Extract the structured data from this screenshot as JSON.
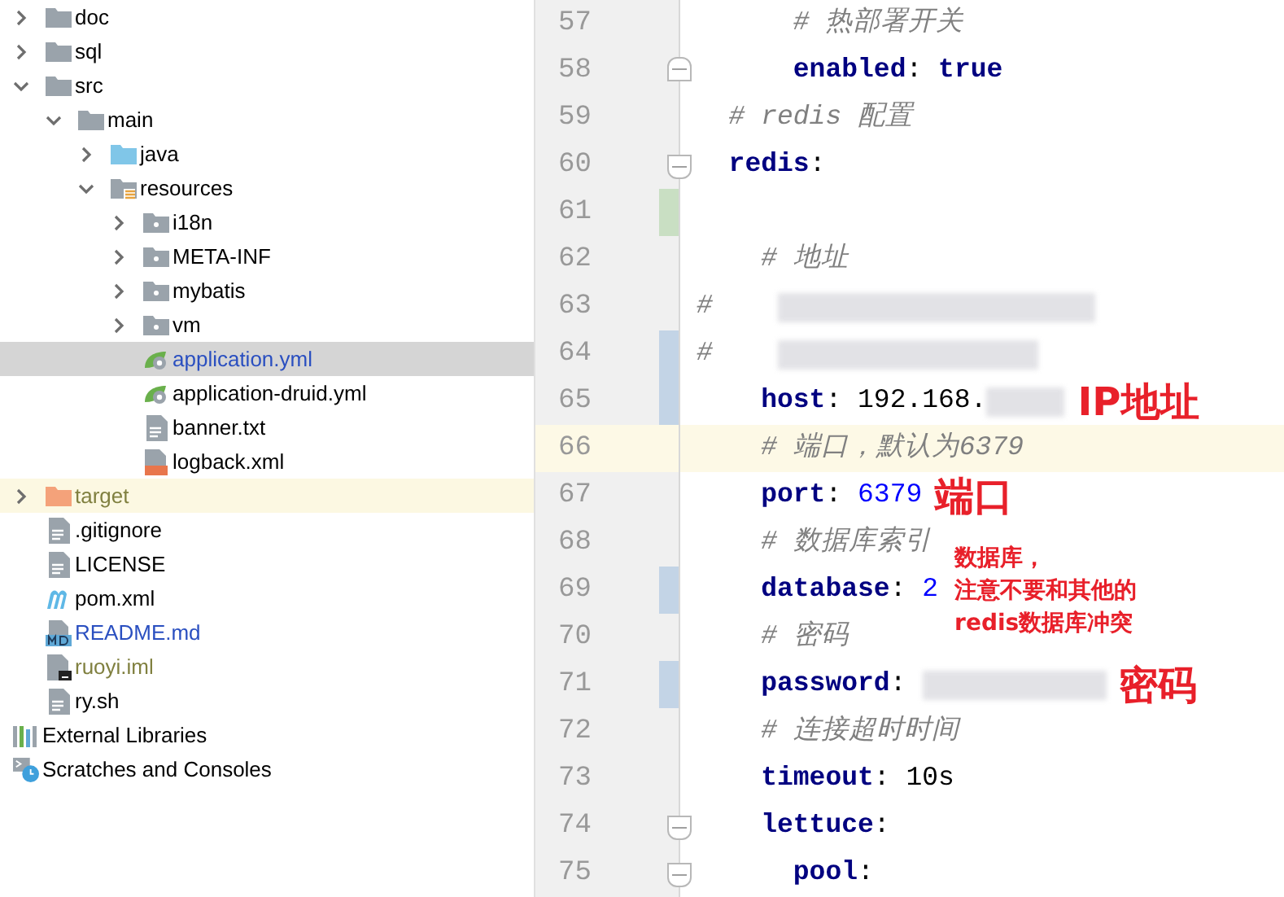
{
  "project_tree": [
    {
      "label": "doc",
      "kind": "folder",
      "expanded": false,
      "selected": false,
      "modified": false,
      "ignored": false
    },
    {
      "label": "sql",
      "kind": "folder",
      "expanded": false,
      "selected": false,
      "modified": false,
      "ignored": false
    },
    {
      "label": "src",
      "kind": "folder",
      "expanded": true,
      "selected": false,
      "modified": false,
      "ignored": false,
      "children": [
        {
          "label": "main",
          "kind": "folder",
          "expanded": true,
          "selected": false,
          "modified": false,
          "ignored": false,
          "children": [
            {
              "label": "java",
              "kind": "source_folder",
              "expanded": false,
              "selected": false,
              "modified": false,
              "ignored": false
            },
            {
              "label": "resources",
              "kind": "resources_folder",
              "expanded": true,
              "selected": false,
              "modified": false,
              "ignored": false,
              "children": [
                {
                  "label": "i18n",
                  "kind": "package_folder",
                  "expanded": false,
                  "selected": false,
                  "modified": false,
                  "ignored": false
                },
                {
                  "label": "META-INF",
                  "kind": "package_folder",
                  "expanded": false,
                  "selected": false,
                  "modified": false,
                  "ignored": false
                },
                {
                  "label": "mybatis",
                  "kind": "package_folder",
                  "expanded": false,
                  "selected": false,
                  "modified": false,
                  "ignored": false
                },
                {
                  "label": "vm",
                  "kind": "package_folder",
                  "expanded": false,
                  "selected": false,
                  "modified": false,
                  "ignored": false
                },
                {
                  "label": "application.yml",
                  "kind": "spring_yml",
                  "selected": true,
                  "modified": true,
                  "ignored": false
                },
                {
                  "label": "application-druid.yml",
                  "kind": "spring_yml",
                  "selected": false,
                  "modified": false,
                  "ignored": false
                },
                {
                  "label": "banner.txt",
                  "kind": "text_file",
                  "selected": false,
                  "modified": false,
                  "ignored": false
                },
                {
                  "label": "logback.xml",
                  "kind": "xml_file",
                  "selected": false,
                  "modified": false,
                  "ignored": false
                }
              ]
            }
          ]
        }
      ]
    },
    {
      "label": "target",
      "kind": "excluded_folder",
      "expanded": false,
      "selected": false,
      "modified": false,
      "ignored": true
    },
    {
      "label": ".gitignore",
      "kind": "text_file",
      "selected": false,
      "modified": false,
      "ignored": false
    },
    {
      "label": "LICENSE",
      "kind": "text_file",
      "selected": false,
      "modified": false,
      "ignored": false
    },
    {
      "label": "pom.xml",
      "kind": "maven_file",
      "selected": false,
      "modified": false,
      "ignored": false
    },
    {
      "label": "README.md",
      "kind": "markdown_file",
      "selected": false,
      "modified": true,
      "ignored": false
    },
    {
      "label": "ruoyi.iml",
      "kind": "module_file",
      "selected": false,
      "modified": false,
      "ignored": true
    },
    {
      "label": "ry.sh",
      "kind": "text_file",
      "selected": false,
      "modified": false,
      "ignored": false
    }
  ],
  "root_items": [
    {
      "label": "External Libraries",
      "kind": "libraries",
      "selected": false
    },
    {
      "label": "Scratches and Consoles",
      "kind": "scratches",
      "selected": false
    }
  ],
  "editor_lines": [
    {
      "number": "57",
      "current": false,
      "added": false,
      "modified": false,
      "fold_start": false,
      "fold_end": false,
      "tokens": [
        {
          "kind": "comment",
          "text": "      # 热部署开关"
        }
      ]
    },
    {
      "number": "58",
      "current": false,
      "added": false,
      "modified": false,
      "fold_start": false,
      "fold_end": true,
      "tokens": [
        {
          "kind": "key",
          "text": "      enabled"
        },
        {
          "kind": "plain",
          "text": ": "
        },
        {
          "kind": "key",
          "text": "true"
        }
      ]
    },
    {
      "number": "59",
      "current": false,
      "added": false,
      "modified": false,
      "fold_start": false,
      "fold_end": false,
      "tokens": [
        {
          "kind": "comment",
          "text": "  # redis 配置"
        }
      ]
    },
    {
      "number": "60",
      "current": false,
      "added": false,
      "modified": false,
      "fold_start": true,
      "fold_end": false,
      "tokens": [
        {
          "kind": "key",
          "text": "  redis"
        },
        {
          "kind": "plain",
          "text": ":"
        }
      ]
    },
    {
      "number": "61",
      "current": false,
      "added": true,
      "modified": false,
      "fold_start": false,
      "fold_end": false
    },
    {
      "number": "62",
      "current": false,
      "added": false,
      "modified": false,
      "fold_start": false,
      "fold_end": false,
      "tokens": [
        {
          "kind": "comment",
          "text": "    # 地址"
        }
      ]
    },
    {
      "number": "63",
      "current": false,
      "added": false,
      "modified": false,
      "fold_start": false,
      "fold_end": false,
      "tokens": [
        {
          "kind": "comment",
          "text": "#    "
        },
        {
          "kind": "redacted_long"
        }
      ]
    },
    {
      "number": "64",
      "current": false,
      "added": false,
      "modified": true,
      "fold_start": false,
      "fold_end": false,
      "tokens": [
        {
          "kind": "comment",
          "text": "#    "
        },
        {
          "kind": "redacted_medium"
        }
      ]
    },
    {
      "number": "65",
      "current": false,
      "added": false,
      "modified": true,
      "fold_start": false,
      "fold_end": false,
      "tokens": [
        {
          "kind": "key",
          "text": "    host"
        },
        {
          "kind": "plain",
          "text": ": 192.168."
        },
        {
          "kind": "redacted_short"
        },
        {
          "kind": "note",
          "text": "IP地址"
        }
      ]
    },
    {
      "number": "66",
      "current": true,
      "added": false,
      "modified": false,
      "fold_start": false,
      "fold_end": false,
      "tokens": [
        {
          "kind": "comment",
          "text": "    # 端口，默认为6379"
        }
      ]
    },
    {
      "number": "67",
      "current": false,
      "added": false,
      "modified": false,
      "fold_start": false,
      "fold_end": false,
      "tokens": [
        {
          "kind": "key",
          "text": "    port"
        },
        {
          "kind": "plain",
          "text": ": "
        },
        {
          "kind": "number",
          "text": "6379"
        },
        {
          "kind": "note",
          "text": "端口"
        }
      ]
    },
    {
      "number": "68",
      "current": false,
      "added": false,
      "modified": false,
      "fold_start": false,
      "fold_end": false,
      "tokens": [
        {
          "kind": "comment",
          "text": "    # 数据库索引"
        }
      ]
    },
    {
      "number": "69",
      "current": false,
      "added": false,
      "modified": true,
      "fold_start": false,
      "fold_end": false,
      "tokens": [
        {
          "kind": "key",
          "text": "    database"
        },
        {
          "kind": "plain",
          "text": ": "
        },
        {
          "kind": "number",
          "text": "2"
        },
        {
          "kind": "note_block",
          "lines": [
            "数据库，",
            "注意不要和其他的",
            "redis数据库冲突"
          ]
        }
      ]
    },
    {
      "number": "70",
      "current": false,
      "added": false,
      "modified": false,
      "fold_start": false,
      "fold_end": false,
      "tokens": [
        {
          "kind": "comment",
          "text": "    # 密码"
        }
      ]
    },
    {
      "number": "71",
      "current": false,
      "added": false,
      "modified": true,
      "fold_start": false,
      "fold_end": false,
      "tokens": [
        {
          "kind": "key",
          "text": "    password"
        },
        {
          "kind": "plain",
          "text": ": "
        },
        {
          "kind": "redacted_password"
        },
        {
          "kind": "note",
          "text": "密码"
        }
      ]
    },
    {
      "number": "72",
      "current": false,
      "added": false,
      "modified": false,
      "fold_start": false,
      "fold_end": false,
      "tokens": [
        {
          "kind": "comment",
          "text": "    # 连接超时时间"
        }
      ]
    },
    {
      "number": "73",
      "current": false,
      "added": false,
      "modified": false,
      "fold_start": false,
      "fold_end": false,
      "tokens": [
        {
          "kind": "key",
          "text": "    timeout"
        },
        {
          "kind": "plain",
          "text": ": 10s"
        }
      ]
    },
    {
      "number": "74",
      "current": false,
      "added": false,
      "modified": false,
      "fold_start": true,
      "fold_end": false,
      "tokens": [
        {
          "kind": "key",
          "text": "    lettuce"
        },
        {
          "kind": "plain",
          "text": ":"
        }
      ]
    },
    {
      "number": "75",
      "current": false,
      "added": false,
      "modified": false,
      "fold_start": true,
      "fold_end": false,
      "tokens": [
        {
          "kind": "key",
          "text": "      pool"
        },
        {
          "kind": "plain",
          "text": ":"
        }
      ]
    }
  ]
}
